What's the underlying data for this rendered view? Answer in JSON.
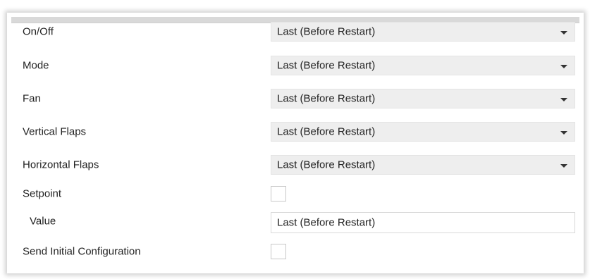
{
  "settings": {
    "on_off": {
      "label": "On/Off",
      "value": "Last (Before Restart)"
    },
    "mode": {
      "label": "Mode",
      "value": "Last (Before Restart)"
    },
    "fan": {
      "label": "Fan",
      "value": "Last (Before Restart)"
    },
    "vertical_flaps": {
      "label": "Vertical Flaps",
      "value": "Last (Before Restart)"
    },
    "horizontal_flaps": {
      "label": "Horizontal Flaps",
      "value": "Last (Before Restart)"
    },
    "setpoint": {
      "label": "Setpoint",
      "checked": false
    },
    "setpoint_value": {
      "label": "Value",
      "value": "Last (Before Restart)"
    },
    "send_initial_configuration": {
      "label": "Send Initial Configuration",
      "checked": false
    }
  },
  "icons": {
    "dropdown": "chevron-down-icon"
  }
}
